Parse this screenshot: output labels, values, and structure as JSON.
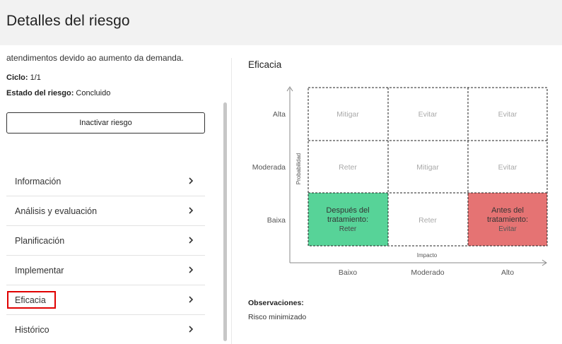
{
  "header": {
    "title": "Detalles del riesgo"
  },
  "left": {
    "cut_text": "atendimentos devido ao aumento da demanda.",
    "cycle_label": "Ciclo:",
    "cycle_value": "1/1",
    "state_label": "Estado del riesgo:",
    "state_value": "Concluido",
    "inactivate_button": "Inactivar riesgo",
    "nav_items": [
      {
        "label": "Información"
      },
      {
        "label": "Análisis y evaluación"
      },
      {
        "label": "Planificación"
      },
      {
        "label": "Implementar"
      },
      {
        "label": "Eficacia",
        "active": true
      },
      {
        "label": "Histórico"
      }
    ]
  },
  "right": {
    "title": "Eficacia",
    "matrix": {
      "y_axis_label": "Probabilidad",
      "x_axis_label": "Impacto",
      "rows": [
        "Alta",
        "Moderada",
        "Baixa"
      ],
      "cols": [
        "Baixo",
        "Moderado",
        "Alto"
      ],
      "cells": [
        [
          "Mitigar",
          "Evitar",
          "Evitar"
        ],
        [
          "Reter",
          "Mitigar",
          "Evitar"
        ],
        [
          "Reter",
          "Reter",
          "Evitar"
        ]
      ],
      "after_treatment": {
        "row": 2,
        "col": 0,
        "label_line1": "Después del",
        "label_line2": "tratamiento:",
        "color": "#57d398"
      },
      "before_treatment": {
        "row": 2,
        "col": 2,
        "label_line1": "Antes del",
        "label_line2": "tratamiento:",
        "color": "#e57373"
      }
    },
    "observations_label": "Observaciones:",
    "observations_value": "Risco minimizado"
  },
  "colors": {
    "header_bg": "#f2f2f2",
    "active_outline": "#e00000",
    "cell_text": "#a9a9a9"
  }
}
